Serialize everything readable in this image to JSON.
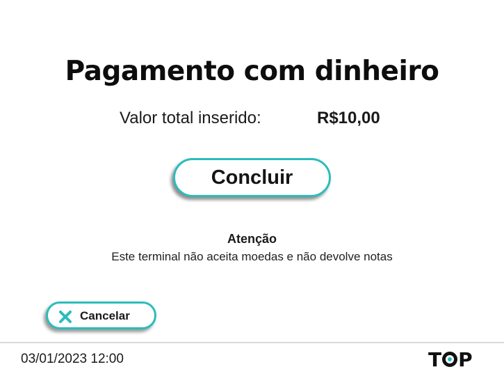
{
  "screen": {
    "title": "Pagamento com dinheiro"
  },
  "total": {
    "label": "Valor total inserido:",
    "value": "R$10,00"
  },
  "actions": {
    "conclude_label": "Concluir",
    "cancel_label": "Cancelar",
    "cancel_icon": "close-x-icon"
  },
  "notice": {
    "title": "Atenção",
    "text": "Este terminal não aceita moedas e não devolve notas"
  },
  "footer": {
    "datetime": "03/01/2023 12:00",
    "logo_text_left": "T",
    "logo_text_right": "P",
    "logo_name": "TOP"
  },
  "colors": {
    "accent": "#2bbcbc",
    "text": "#1a1a1a",
    "background": "#ffffff",
    "divider": "#d9d9d9"
  }
}
